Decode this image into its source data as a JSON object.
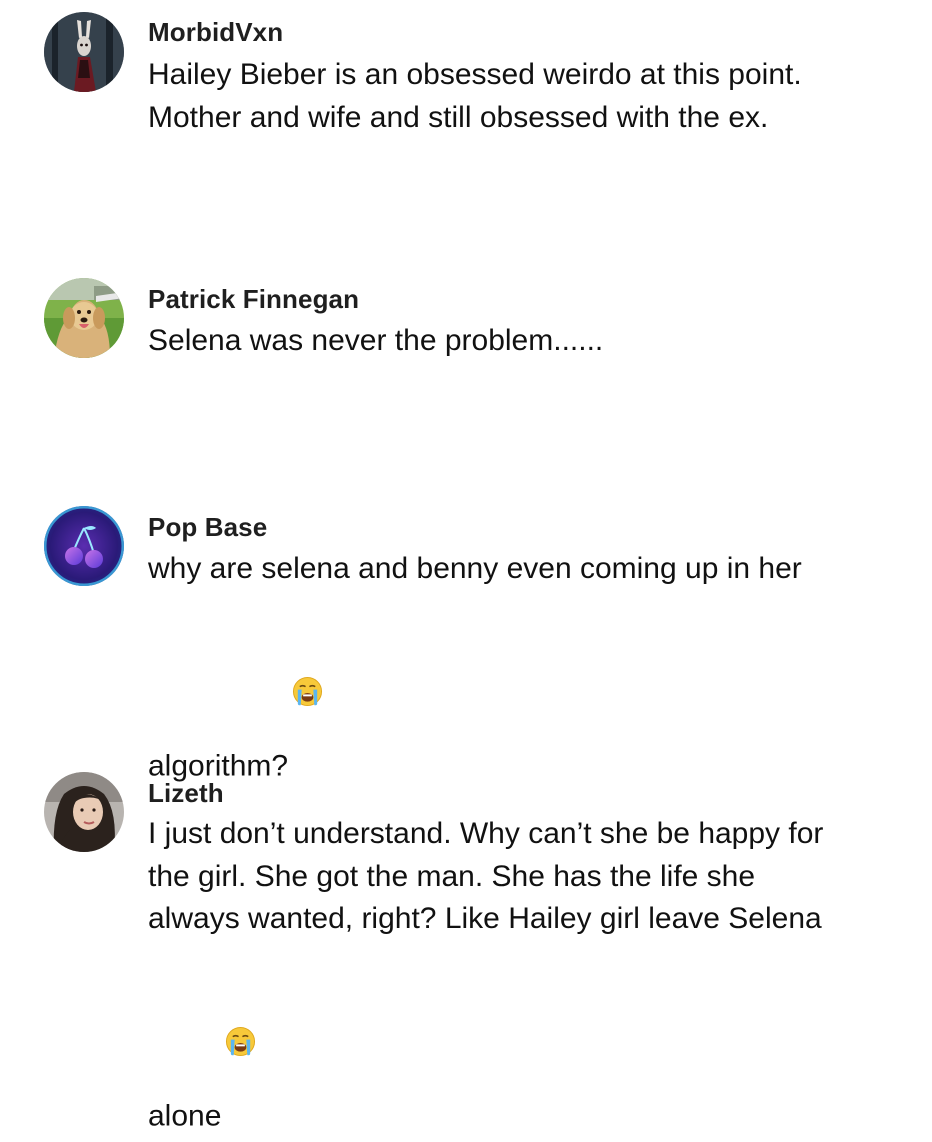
{
  "comments": [
    {
      "username": "MorbidVxn",
      "text": "Hailey Bieber is an obsessed weirdo at this point.\nMother and wife and still obsessed with the ex.",
      "emoji": "",
      "avatar_icon": "masked-figure-avatar-icon"
    },
    {
      "username": "Patrick Finnegan",
      "text": "Selena was never the problem......",
      "emoji": "",
      "avatar_icon": "golden-retriever-avatar-icon"
    },
    {
      "username": "Pop Base",
      "text": "why are selena and benny even coming up in her\nalgorithm?",
      "emoji": "loudly-crying-face",
      "avatar_icon": "cherry-logo-avatar-icon"
    },
    {
      "username": "Lizeth",
      "text": "I just don’t understand. Why can’t she be happy for\nthe girl. She got the man. She has the life she\nalways wanted, right? Like Hailey girl leave Selena\nalone",
      "emoji": "loudly-crying-face",
      "avatar_icon": "woman-portrait-avatar-icon"
    }
  ],
  "colors": {
    "background": "#ffffff",
    "text": "#161823",
    "popbase_gradient": [
      "#2b1a6e",
      "#3a7bd5"
    ]
  }
}
